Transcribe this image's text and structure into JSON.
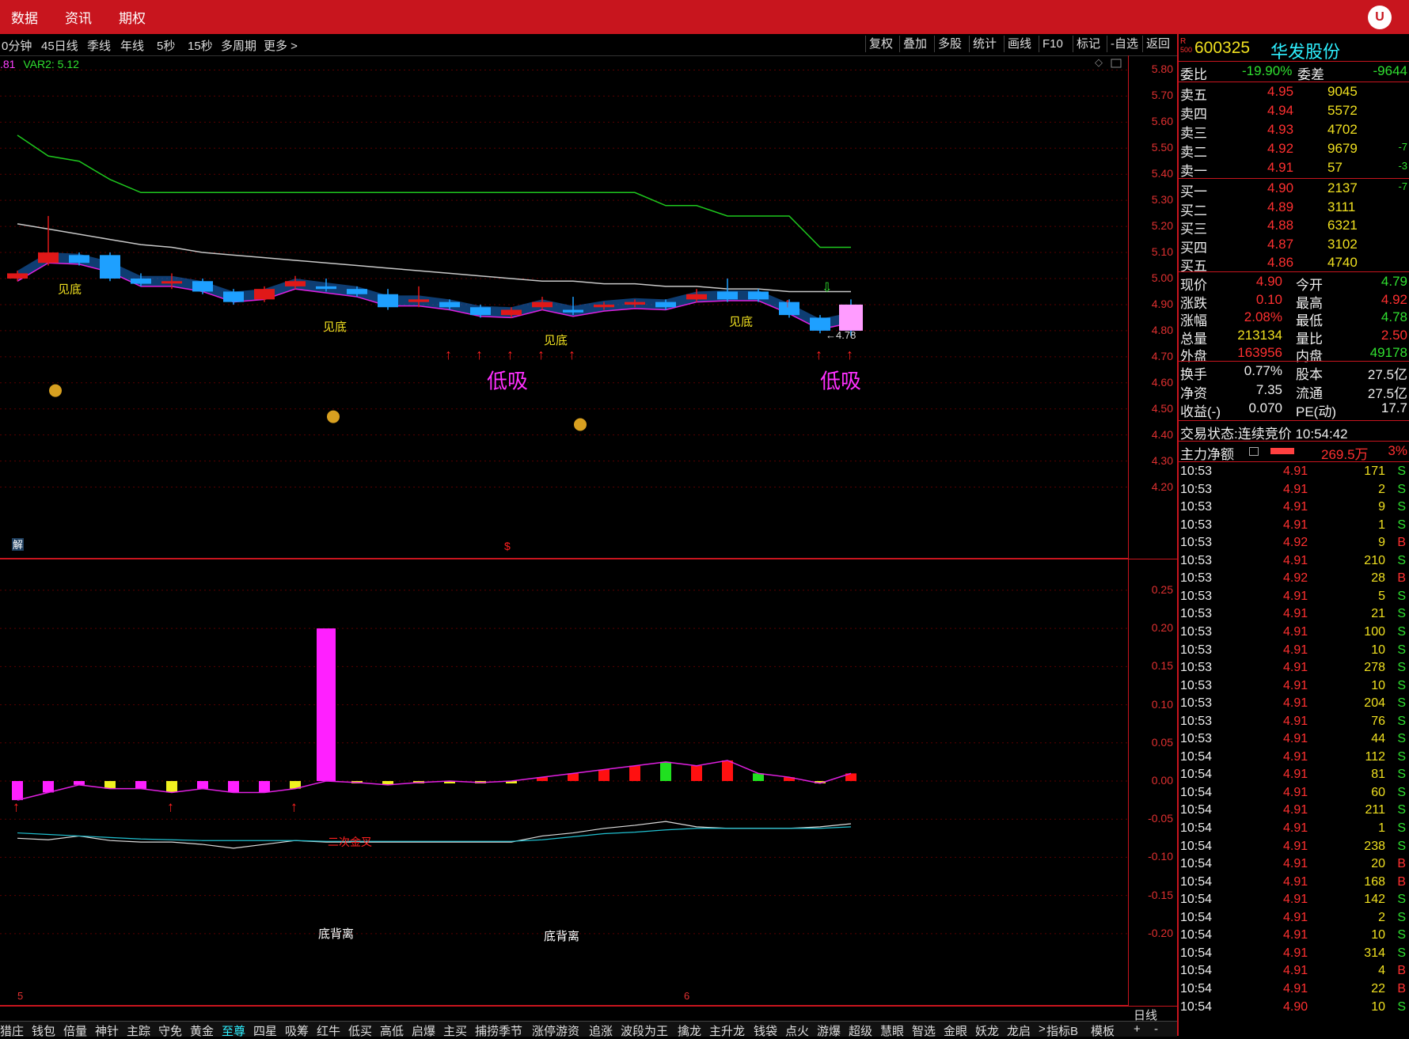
{
  "topbar": {
    "items": [
      "数据",
      "资讯",
      "期权"
    ],
    "logo": "U"
  },
  "toolbar": {
    "periods": [
      "0分钟",
      "45日线",
      "季线",
      "年线",
      "5秒",
      "15秒",
      "多周期",
      "更多 >"
    ],
    "buttons": [
      "复权",
      "叠加",
      "多股",
      "统计",
      "画线",
      "F10",
      "标记",
      "-自选",
      "返回"
    ]
  },
  "indicator_line": {
    "left": ".81",
    "var2": "VAR2: 5.12"
  },
  "chart_labels": {
    "jiandi": [
      "见底",
      "见底",
      "见底",
      "见底"
    ],
    "dixi": [
      "低吸",
      "低吸"
    ],
    "price_tag": "←4.78",
    "jie": "解",
    "dollar": "$",
    "erci": "二次金叉",
    "dibeili": [
      "底背离",
      "底背离"
    ],
    "x_ticks": [
      "5",
      "6"
    ]
  },
  "main_axis": [
    "5.80",
    "5.70",
    "5.60",
    "5.50",
    "5.40",
    "5.30",
    "5.20",
    "5.10",
    "5.00",
    "4.90",
    "4.80",
    "4.70",
    "4.60",
    "4.50",
    "4.40",
    "4.30",
    "4.20"
  ],
  "sub_axis": [
    "0.25",
    "0.20",
    "0.15",
    "0.10",
    "0.05",
    "0.00",
    "-0.05",
    "-0.10",
    "-0.15",
    "-0.20"
  ],
  "chart_data": {
    "type": "candlestick",
    "price_ylim": [
      4.15,
      5.85
    ],
    "candles": [
      {
        "o": 5.0,
        "c": 5.02,
        "h": 5.03,
        "l": 4.99,
        "up": false
      },
      {
        "o": 5.1,
        "c": 5.06,
        "h": 5.24,
        "l": 5.05,
        "up": false
      },
      {
        "o": 5.06,
        "c": 5.09,
        "h": 5.1,
        "l": 5.05,
        "up": true
      },
      {
        "o": 5.09,
        "c": 5.0,
        "h": 5.1,
        "l": 4.99,
        "up": true
      },
      {
        "o": 5.0,
        "c": 4.98,
        "h": 5.02,
        "l": 4.97,
        "up": true
      },
      {
        "o": 4.99,
        "c": 4.99,
        "h": 5.02,
        "l": 4.96,
        "up": false
      },
      {
        "o": 4.99,
        "c": 4.95,
        "h": 5.0,
        "l": 4.94,
        "up": true
      },
      {
        "o": 4.95,
        "c": 4.91,
        "h": 4.96,
        "l": 4.9,
        "up": true
      },
      {
        "o": 4.96,
        "c": 4.92,
        "h": 4.97,
        "l": 4.91,
        "up": false
      },
      {
        "o": 4.99,
        "c": 4.97,
        "h": 5.01,
        "l": 4.96,
        "up": false
      },
      {
        "o": 4.97,
        "c": 4.96,
        "h": 5.0,
        "l": 4.95,
        "up": true
      },
      {
        "o": 4.96,
        "c": 4.94,
        "h": 4.97,
        "l": 4.93,
        "up": true
      },
      {
        "o": 4.94,
        "c": 4.89,
        "h": 4.96,
        "l": 4.88,
        "up": true
      },
      {
        "o": 4.92,
        "c": 4.91,
        "h": 4.97,
        "l": 4.89,
        "up": false
      },
      {
        "o": 4.91,
        "c": 4.89,
        "h": 4.92,
        "l": 4.88,
        "up": true
      },
      {
        "o": 4.89,
        "c": 4.86,
        "h": 4.9,
        "l": 4.85,
        "up": true
      },
      {
        "o": 4.88,
        "c": 4.86,
        "h": 4.89,
        "l": 4.85,
        "up": false
      },
      {
        "o": 4.91,
        "c": 4.89,
        "h": 4.93,
        "l": 4.88,
        "up": false
      },
      {
        "o": 4.88,
        "c": 4.87,
        "h": 4.93,
        "l": 4.86,
        "up": true
      },
      {
        "o": 4.9,
        "c": 4.89,
        "h": 4.91,
        "l": 4.88,
        "up": false
      },
      {
        "o": 4.91,
        "c": 4.9,
        "h": 4.92,
        "l": 4.89,
        "up": false
      },
      {
        "o": 4.91,
        "c": 4.89,
        "h": 4.92,
        "l": 4.88,
        "up": true
      },
      {
        "o": 4.94,
        "c": 4.92,
        "h": 4.96,
        "l": 4.91,
        "up": false
      },
      {
        "o": 4.95,
        "c": 4.92,
        "h": 5.0,
        "l": 4.91,
        "up": true
      },
      {
        "o": 4.95,
        "c": 4.92,
        "h": 4.96,
        "l": 4.91,
        "up": true
      },
      {
        "o": 4.91,
        "c": 4.86,
        "h": 4.92,
        "l": 4.85,
        "up": true
      },
      {
        "o": 4.85,
        "c": 4.8,
        "h": 4.86,
        "l": 4.79,
        "up": true
      },
      {
        "o": 4.8,
        "c": 4.9,
        "h": 4.92,
        "l": 4.78,
        "up": true
      }
    ],
    "ma_upper": [
      5.55,
      5.47,
      5.45,
      5.38,
      5.33,
      5.33,
      5.33,
      5.33,
      5.33,
      5.33,
      5.33,
      5.33,
      5.33,
      5.33,
      5.33,
      5.33,
      5.33,
      5.33,
      5.33,
      5.33,
      5.33,
      5.28,
      5.28,
      5.24,
      5.24,
      5.24,
      5.12,
      5.12
    ],
    "ma_white": [
      5.21,
      5.19,
      5.17,
      5.15,
      5.13,
      5.12,
      5.1,
      5.09,
      5.08,
      5.07,
      5.06,
      5.05,
      5.04,
      5.03,
      5.02,
      5.01,
      5.0,
      4.99,
      4.99,
      4.98,
      4.98,
      4.97,
      4.97,
      4.96,
      4.96,
      4.95,
      4.95,
      4.95
    ],
    "sub_ylim": [
      -0.28,
      0.28
    ],
    "sub_bars": [
      -0.025,
      -0.015,
      -0.005,
      -0.01,
      -0.01,
      -0.015,
      -0.01,
      -0.015,
      -0.015,
      -0.01,
      0.2,
      -0.002,
      -0.005,
      -0.002,
      0.0,
      -0.002,
      0.0,
      0.005,
      0.01,
      0.015,
      0.02,
      0.025,
      0.02,
      0.027,
      0.01,
      0.005,
      -0.003,
      0.01
    ],
    "sub_line_white": [
      -0.075,
      -0.077,
      -0.072,
      -0.078,
      -0.08,
      -0.08,
      -0.083,
      -0.088,
      -0.083,
      -0.078,
      -0.08,
      -0.08,
      -0.08,
      -0.08,
      -0.08,
      -0.08,
      -0.08,
      -0.072,
      -0.068,
      -0.062,
      -0.058,
      -0.053,
      -0.06,
      -0.062,
      -0.062,
      -0.062,
      -0.06,
      -0.056
    ],
    "sub_line_cyan": [
      -0.068,
      -0.07,
      -0.072,
      -0.074,
      -0.076,
      -0.077,
      -0.078,
      -0.078,
      -0.078,
      -0.078,
      -0.079,
      -0.079,
      -0.079,
      -0.079,
      -0.079,
      -0.079,
      -0.079,
      -0.077,
      -0.073,
      -0.069,
      -0.067,
      -0.064,
      -0.062,
      -0.062,
      -0.062,
      -0.062,
      -0.062,
      -0.06
    ]
  },
  "quote": {
    "badge_top": "R",
    "badge_bottom": "500",
    "code": "600325",
    "name": "华发股份",
    "weibi_label": "委比",
    "weibi": "-19.90%",
    "weicha_label": "委差",
    "weicha": "-9644",
    "sell": [
      {
        "label": "卖五",
        "price": "4.95",
        "vol": "9045",
        "chg": ""
      },
      {
        "label": "卖四",
        "price": "4.94",
        "vol": "5572",
        "chg": ""
      },
      {
        "label": "卖三",
        "price": "4.93",
        "vol": "4702",
        "chg": ""
      },
      {
        "label": "卖二",
        "price": "4.92",
        "vol": "9679",
        "chg": "-7"
      },
      {
        "label": "卖一",
        "price": "4.91",
        "vol": "57",
        "chg": "-3"
      }
    ],
    "buy": [
      {
        "label": "买一",
        "price": "4.90",
        "vol": "2137",
        "chg": "-7"
      },
      {
        "label": "买二",
        "price": "4.89",
        "vol": "3111",
        "chg": ""
      },
      {
        "label": "买三",
        "price": "4.88",
        "vol": "6321",
        "chg": ""
      },
      {
        "label": "买四",
        "price": "4.87",
        "vol": "3102",
        "chg": ""
      },
      {
        "label": "买五",
        "price": "4.86",
        "vol": "4740",
        "chg": ""
      }
    ],
    "stats": [
      {
        "l1": "现价",
        "v1": "4.90",
        "l2": "今开",
        "v2": "4.79",
        "c1": "red",
        "c2": "green"
      },
      {
        "l1": "涨跌",
        "v1": "0.10",
        "l2": "最高",
        "v2": "4.92",
        "c1": "red",
        "c2": "red"
      },
      {
        "l1": "涨幅",
        "v1": "2.08%",
        "l2": "最低",
        "v2": "4.78",
        "c1": "red",
        "c2": "green"
      },
      {
        "l1": "总量",
        "v1": "213134",
        "l2": "量比",
        "v2": "2.50",
        "c1": "yellow",
        "c2": "red"
      },
      {
        "l1": "外盘",
        "v1": "163956",
        "l2": "内盘",
        "v2": "49178",
        "c1": "red",
        "c2": "green"
      }
    ],
    "stats2": [
      {
        "l1": "换手",
        "v1": "0.77%",
        "l2": "股本",
        "v2": "27.5亿"
      },
      {
        "l1": "净资",
        "v1": "7.35",
        "l2": "流通",
        "v2": "27.5亿"
      },
      {
        "l1": "收益(-)",
        "v1": "0.070",
        "l2": "PE(动)",
        "v2": "17.7"
      }
    ],
    "trade_status": "交易状态:连续竞价 10:54:42",
    "main_net_label": "主力净额",
    "main_net_value": "269.5万",
    "main_net_pct": "3%",
    "main_net_ratio": 0.3
  },
  "ticks": [
    [
      "10:53",
      "4.91",
      "171",
      "S"
    ],
    [
      "10:53",
      "4.91",
      "2",
      "S"
    ],
    [
      "10:53",
      "4.91",
      "9",
      "S"
    ],
    [
      "10:53",
      "4.91",
      "1",
      "S"
    ],
    [
      "10:53",
      "4.92",
      "9",
      "B"
    ],
    [
      "10:53",
      "4.91",
      "210",
      "S"
    ],
    [
      "10:53",
      "4.92",
      "28",
      "B"
    ],
    [
      "10:53",
      "4.91",
      "5",
      "S"
    ],
    [
      "10:53",
      "4.91",
      "21",
      "S"
    ],
    [
      "10:53",
      "4.91",
      "100",
      "S"
    ],
    [
      "10:53",
      "4.91",
      "10",
      "S"
    ],
    [
      "10:53",
      "4.91",
      "278",
      "S"
    ],
    [
      "10:53",
      "4.91",
      "10",
      "S"
    ],
    [
      "10:53",
      "4.91",
      "204",
      "S"
    ],
    [
      "10:53",
      "4.91",
      "76",
      "S"
    ],
    [
      "10:53",
      "4.91",
      "44",
      "S"
    ],
    [
      "10:54",
      "4.91",
      "112",
      "S"
    ],
    [
      "10:54",
      "4.91",
      "81",
      "S"
    ],
    [
      "10:54",
      "4.91",
      "60",
      "S"
    ],
    [
      "10:54",
      "4.91",
      "211",
      "S"
    ],
    [
      "10:54",
      "4.91",
      "1",
      "S"
    ],
    [
      "10:54",
      "4.91",
      "238",
      "S"
    ],
    [
      "10:54",
      "4.91",
      "20",
      "B"
    ],
    [
      "10:54",
      "4.91",
      "168",
      "B"
    ],
    [
      "10:54",
      "4.91",
      "142",
      "S"
    ],
    [
      "10:54",
      "4.91",
      "2",
      "S"
    ],
    [
      "10:54",
      "4.91",
      "10",
      "S"
    ],
    [
      "10:54",
      "4.91",
      "314",
      "S"
    ],
    [
      "10:54",
      "4.91",
      "4",
      "B"
    ],
    [
      "10:54",
      "4.91",
      "22",
      "B"
    ],
    [
      "10:54",
      "4.90",
      "10",
      "S"
    ]
  ],
  "bottom_tabs": [
    "猎庄",
    "钱包",
    "倍量",
    "神针",
    "主踪",
    "守免",
    "黄金",
    "至尊",
    "四星",
    "吸筹",
    "红牛",
    "低买",
    "高低",
    "启爆",
    "主买",
    "捕捞季节",
    "涨停游资",
    "追涨",
    "波段为王",
    "擒龙",
    "主升龙",
    "钱袋",
    "点火",
    "游爆",
    "超级",
    "慧眼",
    "智选",
    "金眼",
    "妖龙",
    "龙启",
    ">",
    "指标B",
    "模板",
    "+",
    "-"
  ],
  "active_tab": "至尊",
  "period_label": "日线"
}
